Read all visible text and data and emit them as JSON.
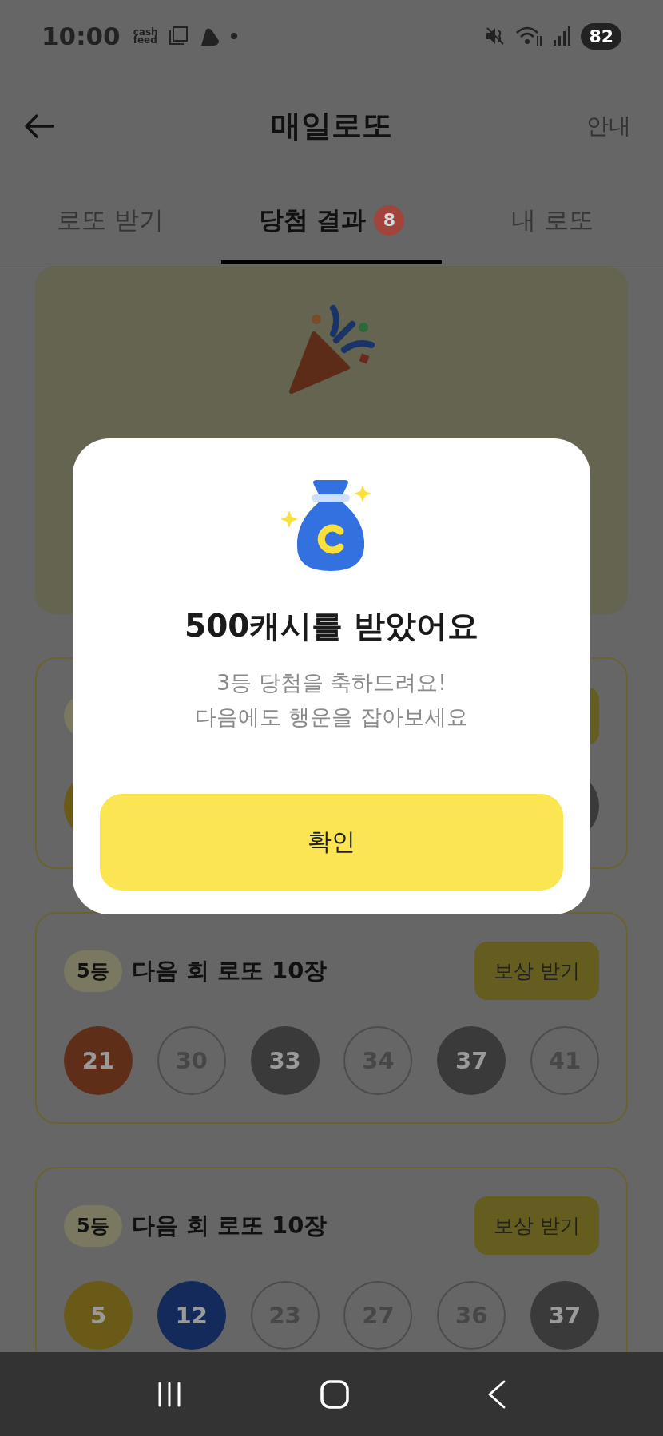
{
  "status_bar": {
    "time": "10:00",
    "app_badge_top": "cash",
    "app_badge_bottom": "feed",
    "battery": "82"
  },
  "header": {
    "title": "매일로또",
    "action": "안내"
  },
  "tabs": [
    {
      "label": "로또 받기",
      "selected": false
    },
    {
      "label": "당첨 결과",
      "selected": true,
      "badge": "8"
    },
    {
      "label": "내 로또",
      "selected": false
    }
  ],
  "cards": [
    {
      "kind": "celebration"
    },
    {
      "kind": "covered",
      "balls": [
        {
          "kind": "filled",
          "color": "#6a5a18"
        },
        {
          "kind": "filled",
          "color": "#3a3a3a"
        }
      ]
    },
    {
      "kind": "prize",
      "rank": "5등",
      "title": "다음 회 로또 10장",
      "button": "보상 받기",
      "balls": [
        {
          "number": "21",
          "kind": "filled",
          "color": "#5f2e18"
        },
        {
          "number": "30",
          "kind": "outline"
        },
        {
          "number": "33",
          "kind": "filled",
          "color": "#3a3a3a"
        },
        {
          "number": "34",
          "kind": "outline"
        },
        {
          "number": "37",
          "kind": "filled",
          "color": "#3a3a3a"
        },
        {
          "number": "41",
          "kind": "outline"
        }
      ]
    },
    {
      "kind": "prize",
      "rank": "5등",
      "title": "다음 회 로또 10장",
      "button": "보상 받기",
      "balls": [
        {
          "number": "5",
          "kind": "filled",
          "color": "#6a5a18"
        },
        {
          "number": "12",
          "kind": "filled",
          "color": "#132a5a"
        },
        {
          "number": "23",
          "kind": "outline"
        },
        {
          "number": "27",
          "kind": "outline"
        },
        {
          "number": "36",
          "kind": "outline"
        },
        {
          "number": "37",
          "kind": "filled",
          "color": "#3a3a3a"
        }
      ]
    }
  ],
  "dialog": {
    "title": "500캐시를 받았어요",
    "lines": [
      "3등 당첨을 축하드려요!",
      "다음에도 행운을 잡아보세요"
    ],
    "button": "확인"
  }
}
